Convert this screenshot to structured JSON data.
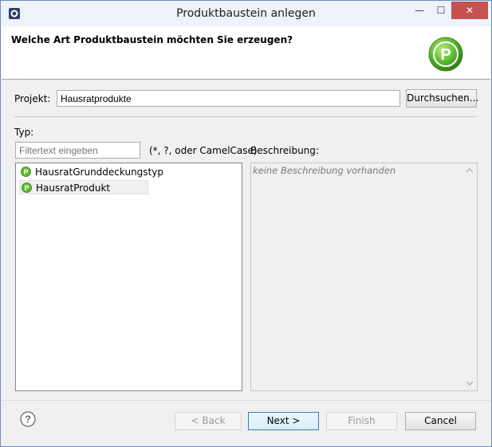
{
  "window": {
    "title": "Produktbaustein anlegen",
    "minimize": "—",
    "maximize": "☐",
    "close": "✕"
  },
  "header": {
    "title": "Welche Art Produktbaustein möchten Sie erzeugen?",
    "logo_letter": "P"
  },
  "project": {
    "label": "Projekt:",
    "value": "Hausratprodukte",
    "browse_label": "Durchsuchen..."
  },
  "type": {
    "label": "Typ:",
    "filter_placeholder": "Filtertext eingeben",
    "filter_hint": "(*, ?, oder CamelCase)",
    "items": [
      {
        "label": "HausratGrunddeckungstyp",
        "selected": false
      },
      {
        "label": "HausratProdukt",
        "selected": true
      }
    ]
  },
  "description": {
    "label": "Beschreibung:",
    "text": "keine Beschreibung vorhanden"
  },
  "buttons": {
    "back": "< Back",
    "next": "Next >",
    "finish": "Finish",
    "cancel": "Cancel"
  },
  "colors": {
    "accent": "#3c7fb1",
    "logo_green": "#5cb82e",
    "close_red": "#c75050"
  }
}
